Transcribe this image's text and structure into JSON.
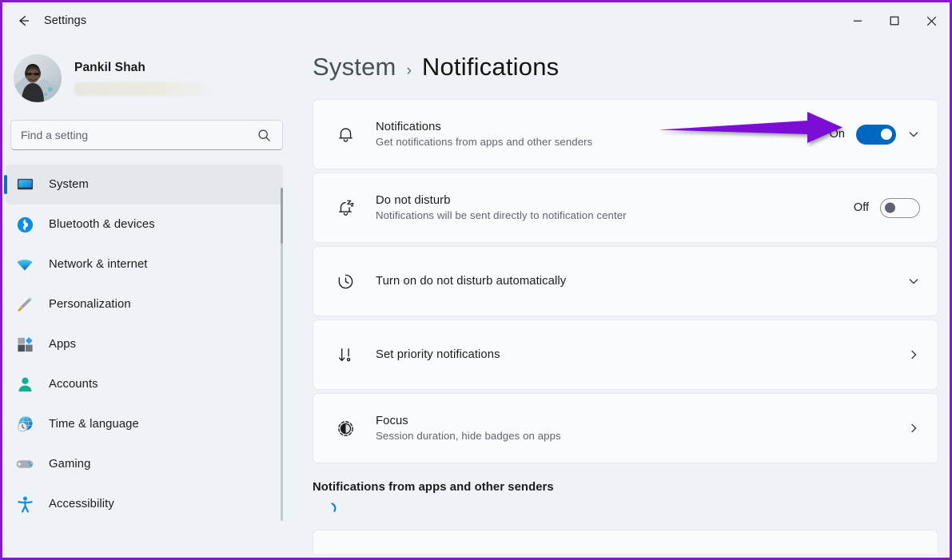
{
  "window": {
    "title": "Settings",
    "back_icon": "back-arrow-icon",
    "minimize_label": "Minimize",
    "maximize_label": "Maximize",
    "close_label": "Close"
  },
  "accent_colors": {
    "toggle_on": "#0067C0",
    "selection_indicator": "#0F6CBD",
    "annotation_arrow": "#7B0FD4",
    "spinner": "#0F7BC4",
    "window_border": "#8A17C9"
  },
  "sidebar": {
    "profile": {
      "name": "Pankil Shah",
      "email_redacted": true
    },
    "search": {
      "placeholder": "Find a setting",
      "value": "",
      "icon": "search-icon"
    },
    "items": [
      {
        "label": "System",
        "icon": "system-icon",
        "active": true
      },
      {
        "label": "Bluetooth & devices",
        "icon": "bluetooth-icon",
        "active": false
      },
      {
        "label": "Network & internet",
        "icon": "wifi-icon",
        "active": false
      },
      {
        "label": "Personalization",
        "icon": "paintbrush-icon",
        "active": false
      },
      {
        "label": "Apps",
        "icon": "apps-icon",
        "active": false
      },
      {
        "label": "Accounts",
        "icon": "accounts-icon",
        "active": false
      },
      {
        "label": "Time & language",
        "icon": "clock-globe-icon",
        "active": false
      },
      {
        "label": "Gaming",
        "icon": "gamepad-icon",
        "active": false
      },
      {
        "label": "Accessibility",
        "icon": "accessibility-icon",
        "active": false
      }
    ]
  },
  "breadcrumb": {
    "parent": "System",
    "separator": "›",
    "current": "Notifications"
  },
  "cards": [
    {
      "title": "Notifications",
      "subtitle": "Get notifications from apps and other senders",
      "icon": "bell-icon",
      "control": "toggle",
      "toggle_state": "On",
      "toggle_on": true,
      "expander": "chevron-down-icon",
      "annotated": true
    },
    {
      "title": "Do not disturb",
      "subtitle": "Notifications will be sent directly to notification center",
      "icon": "bell-sleep-icon",
      "control": "toggle",
      "toggle_state": "Off",
      "toggle_on": false,
      "expander": null,
      "annotated": false
    },
    {
      "title": "Turn on do not disturb automatically",
      "subtitle": "",
      "icon": "clock-history-icon",
      "control": "expander",
      "toggle_state": "",
      "toggle_on": false,
      "expander": "chevron-down-icon",
      "annotated": false
    },
    {
      "title": "Set priority notifications",
      "subtitle": "",
      "icon": "priority-arrow-icon",
      "control": "navigate",
      "toggle_state": "",
      "toggle_on": false,
      "expander": "chevron-right-icon",
      "annotated": false
    },
    {
      "title": "Focus",
      "subtitle": "Session duration, hide badges on apps",
      "icon": "focus-timer-icon",
      "control": "navigate",
      "toggle_state": "",
      "toggle_on": false,
      "expander": "chevron-right-icon",
      "annotated": false
    }
  ],
  "bottom_section": {
    "title": "Notifications from apps and other senders",
    "loading": true
  }
}
